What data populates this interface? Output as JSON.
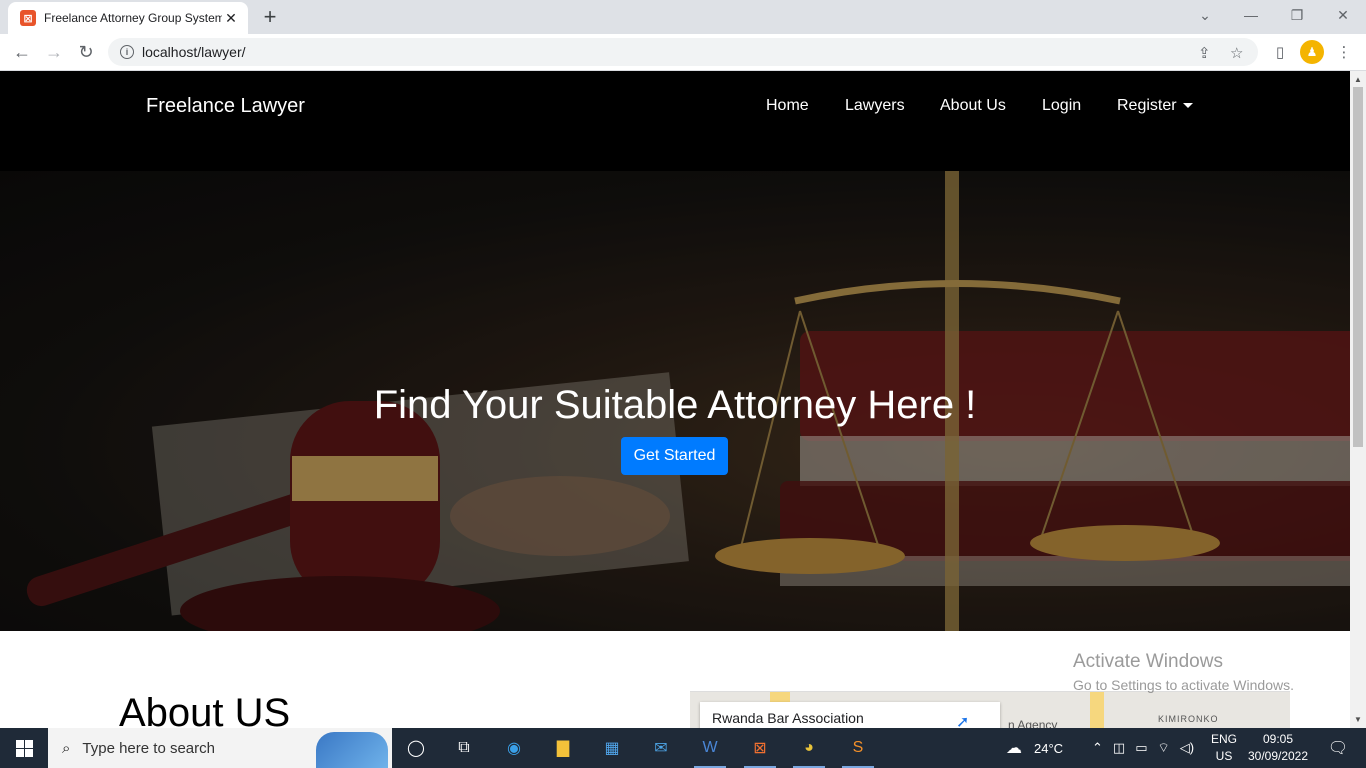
{
  "browser": {
    "tab_title": "Freelance Attorney Group System",
    "tab_favicon": "xampp-icon",
    "url": "localhost/lawyer/"
  },
  "site": {
    "brand": "Freelance Lawyer",
    "nav": [
      "Home",
      "Lawyers",
      "About Us",
      "Login",
      "Register"
    ],
    "hero_title": "Find Your Suitable Attorney Here !",
    "hero_button": "Get Started",
    "about_heading": "About US",
    "map_place": "Rwanda Bar Association",
    "map_label_agency": "n Agency",
    "map_label_area": "KIMIRONKO",
    "accent_color": "#007bff"
  },
  "watermark": {
    "title": "Activate Windows",
    "subtitle": "Go to Settings to activate Windows."
  },
  "taskbar": {
    "search_placeholder": "Type here to search",
    "weather": "24°C",
    "lang_top": "ENG",
    "lang_bottom": "US",
    "time": "09:05",
    "date": "30/09/2022",
    "apps": [
      "cortana-icon",
      "task-view-icon",
      "edge-icon",
      "file-explorer-icon",
      "store-icon",
      "mail-icon",
      "word-icon",
      "xampp-icon",
      "chrome-icon",
      "sublime-icon"
    ]
  }
}
